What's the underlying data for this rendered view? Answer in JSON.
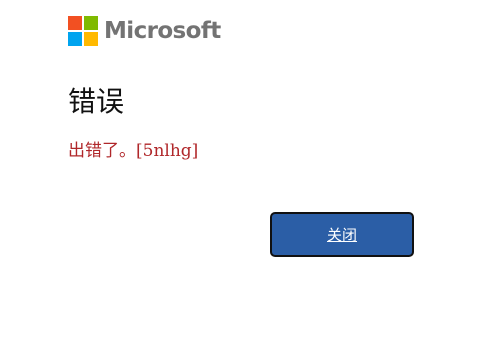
{
  "brand": {
    "name": "Microsoft",
    "logo_colors": [
      "#f25022",
      "#7fba00",
      "#00a4ef",
      "#ffb900"
    ]
  },
  "dialog": {
    "title": "错误",
    "message": "出错了。[5nlhg]",
    "message_color": "#b0272a",
    "close_label": "关闭",
    "button_color": "#2b5ea6"
  }
}
